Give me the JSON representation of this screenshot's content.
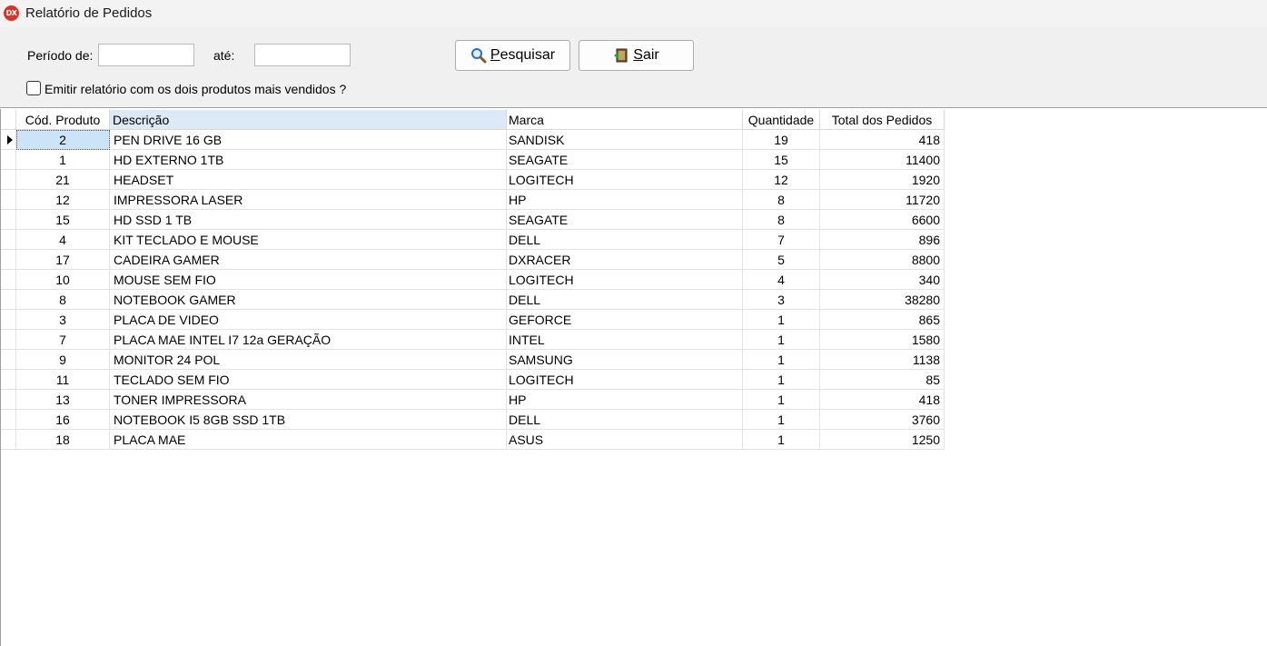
{
  "window": {
    "title": "Relatório de Pedidos",
    "icon_text": "DX",
    "accent_color": "#d9342b"
  },
  "filters": {
    "period_from_label": "Período de:",
    "period_from_value": "",
    "period_to_label": "até:",
    "period_to_value": "",
    "search_button": {
      "mnemonic": "P",
      "rest": "esquisar",
      "icon": "magnifier-icon"
    },
    "exit_button": {
      "mnemonic": "S",
      "rest": "air",
      "icon": "exit-door-icon"
    },
    "top_two_checkbox_label": "Emitir relatório com os dois produtos mais vendidos ?",
    "top_two_checkbox_checked": false
  },
  "grid": {
    "columns": [
      "Cód. Produto",
      "Descrição",
      "Marca",
      "Quantidade",
      "Total dos Pedidos"
    ],
    "selected_row": 0,
    "rows": [
      [
        "2",
        "PEN DRIVE 16 GB",
        "SANDISK",
        "19",
        "418"
      ],
      [
        "1",
        "HD EXTERNO 1TB",
        "SEAGATE",
        "15",
        "11400"
      ],
      [
        "21",
        "HEADSET",
        "LOGITECH",
        "12",
        "1920"
      ],
      [
        "12",
        "IMPRESSORA LASER",
        "HP",
        "8",
        "11720"
      ],
      [
        "15",
        "HD SSD 1 TB",
        "SEAGATE",
        "8",
        "6600"
      ],
      [
        "4",
        "KIT TECLADO E MOUSE",
        "DELL",
        "7",
        "896"
      ],
      [
        "17",
        "CADEIRA GAMER",
        "DXRACER",
        "5",
        "8800"
      ],
      [
        "10",
        "MOUSE SEM FIO",
        "LOGITECH",
        "4",
        "340"
      ],
      [
        "8",
        "NOTEBOOK GAMER",
        "DELL",
        "3",
        "38280"
      ],
      [
        "3",
        "PLACA DE VIDEO",
        "GEFORCE",
        "1",
        "865"
      ],
      [
        "7",
        "PLACA MAE INTEL I7 12a GERAÇÃO",
        "INTEL",
        "1",
        "1580"
      ],
      [
        "9",
        "MONITOR 24 POL",
        "SAMSUNG",
        "1",
        "1138"
      ],
      [
        "11",
        "TECLADO SEM FIO",
        "LOGITECH",
        "1",
        "85"
      ],
      [
        "13",
        "TONER IMPRESSORA",
        "HP",
        "1",
        "418"
      ],
      [
        "16",
        "NOTEBOOK I5 8GB SSD 1TB",
        "DELL",
        "1",
        "3760"
      ],
      [
        "18",
        "PLACA MAE",
        "ASUS",
        "1",
        "1250"
      ]
    ]
  }
}
